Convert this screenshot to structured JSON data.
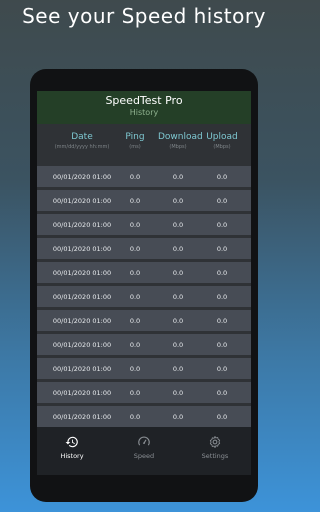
{
  "headline": "See your Speed history",
  "app": {
    "title": "SpeedTest Pro",
    "subtitle": "History"
  },
  "columns": {
    "date": {
      "label": "Date",
      "unit": "(mm/dd/yyyy hh:mm)"
    },
    "ping": {
      "label": "Ping",
      "unit": "(ms)"
    },
    "download": {
      "label": "Download",
      "unit": "(Mbps)"
    },
    "upload": {
      "label": "Upload",
      "unit": "(Mbps)"
    }
  },
  "rows": [
    {
      "date": "00/01/2020 01:00",
      "ping": "0.0",
      "download": "0.0",
      "upload": "0.0"
    },
    {
      "date": "00/01/2020 01:00",
      "ping": "0.0",
      "download": "0.0",
      "upload": "0.0"
    },
    {
      "date": "00/01/2020 01:00",
      "ping": "0.0",
      "download": "0.0",
      "upload": "0.0"
    },
    {
      "date": "00/01/2020 01:00",
      "ping": "0.0",
      "download": "0.0",
      "upload": "0.0"
    },
    {
      "date": "00/01/2020 01:00",
      "ping": "0.0",
      "download": "0.0",
      "upload": "0.0"
    },
    {
      "date": "00/01/2020 01:00",
      "ping": "0.0",
      "download": "0.0",
      "upload": "0.0"
    },
    {
      "date": "00/01/2020 01:00",
      "ping": "0.0",
      "download": "0.0",
      "upload": "0.0"
    },
    {
      "date": "00/01/2020 01:00",
      "ping": "0.0",
      "download": "0.0",
      "upload": "0.0"
    },
    {
      "date": "00/01/2020 01:00",
      "ping": "0.0",
      "download": "0.0",
      "upload": "0.0"
    },
    {
      "date": "00/01/2020 01:00",
      "ping": "0.0",
      "download": "0.0",
      "upload": "0.0"
    },
    {
      "date": "00/01/2020 01:00",
      "ping": "0.0",
      "download": "0.0",
      "upload": "0.0"
    }
  ],
  "nav": {
    "items": [
      {
        "label": "History",
        "icon": "history-icon",
        "active": true
      },
      {
        "label": "Speed",
        "icon": "speedometer-icon",
        "active": false
      },
      {
        "label": "Settings",
        "icon": "gear-icon",
        "active": false
      }
    ]
  },
  "colors": {
    "appbar": "#243f27",
    "column_header": "#7ec8d1",
    "row_bg": "#474c55",
    "nav_active": "#ffffff",
    "nav_inactive": "#8a8f94"
  }
}
